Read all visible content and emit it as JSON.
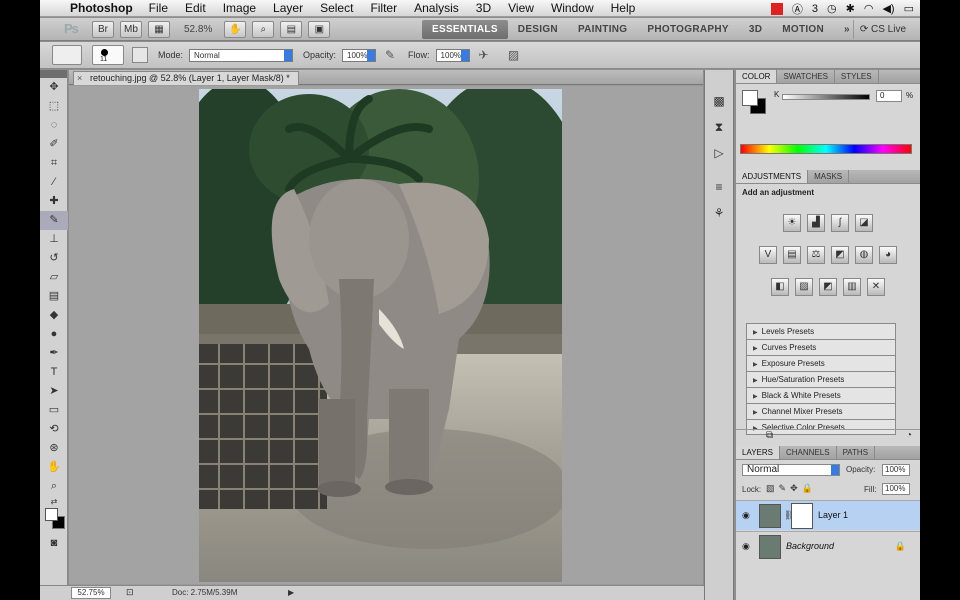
{
  "menubar": {
    "app_name": "Photoshop",
    "menus": [
      "File",
      "Edit",
      "Image",
      "Layer",
      "Select",
      "Filter",
      "Analysis",
      "3D",
      "View",
      "Window",
      "Help"
    ],
    "status_number": "3"
  },
  "appbar": {
    "ps_logo": "Ps",
    "zoom": "52.8%",
    "workspaces": [
      "ESSENTIALS",
      "DESIGN",
      "PAINTING",
      "PHOTOGRAPHY",
      "3D",
      "MOTION"
    ],
    "active_workspace": "ESSENTIALS",
    "more": "»",
    "cs_live": "CS Live"
  },
  "options": {
    "brush_size": "11",
    "mode_label": "Mode:",
    "mode_value": "Normal",
    "opacity_label": "Opacity:",
    "opacity_value": "100%",
    "flow_label": "Flow:",
    "flow_value": "100%"
  },
  "document": {
    "tab_title": "retouching.jpg @ 52.8% (Layer 1, Layer Mask/8) *",
    "tab_close": "×"
  },
  "statusbar": {
    "zoom": "52.75%",
    "doc_size": "Doc: 2.75M/5.39M",
    "arrow": "▶"
  },
  "color_panel": {
    "tabs": [
      "COLOR",
      "SWATCHES",
      "STYLES"
    ],
    "channel": "K",
    "value": "0",
    "unit": "%"
  },
  "adjustments_panel": {
    "tabs": [
      "ADJUSTMENTS",
      "MASKS"
    ],
    "title": "Add an adjustment",
    "presets": [
      "Levels Presets",
      "Curves Presets",
      "Exposure Presets",
      "Hue/Saturation Presets",
      "Black & White Presets",
      "Channel Mixer Presets",
      "Selective Color Presets"
    ]
  },
  "layers_panel": {
    "tabs": [
      "LAYERS",
      "CHANNELS",
      "PATHS"
    ],
    "blend_mode": "Normal",
    "opacity_label": "Opacity:",
    "opacity_value": "100%",
    "lock_label": "Lock:",
    "fill_label": "Fill:",
    "fill_value": "100%",
    "layers": [
      {
        "name": "Layer 1",
        "selected": true
      },
      {
        "name": "Background",
        "selected": false
      }
    ]
  },
  "colors": {
    "accent_blue": "#3a7be0",
    "selected_layer": "#b6d1f2",
    "workspace_active": "#7a7a7a"
  }
}
